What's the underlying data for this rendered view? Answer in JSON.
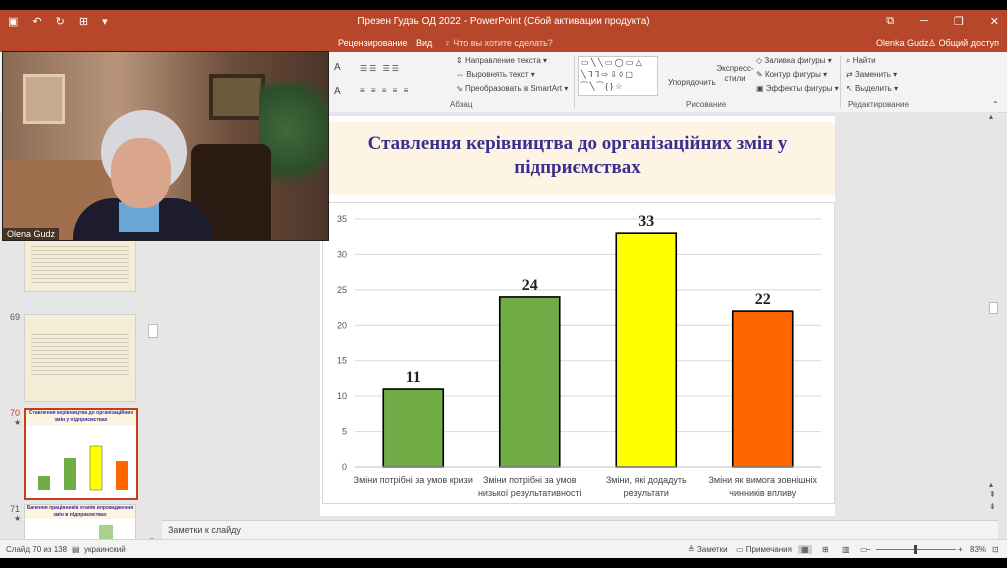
{
  "window": {
    "title": "Презен Гудзь ОД 2022  -  PowerPoint (Сбой активации продукта)",
    "user_name": "Olenka Gudz",
    "share_label": "Общий доступ"
  },
  "tabs": [
    "Рецензирование",
    "Вид"
  ],
  "tell_me": "Что вы хотите сделать?",
  "ribbon": {
    "text_direction": "Направление текста",
    "align_text": "Выровнять текст",
    "smartart": "Преобразовать в SmartArt",
    "paragraph_group": "Абзац",
    "arrange": "Упорядочить",
    "quick_styles": "Экспресс-стили",
    "drawing_group": "Рисование",
    "shape_fill": "Заливка фигуры",
    "shape_outline": "Контур фигуры",
    "shape_effects": "Эффекты фигуры",
    "find": "Найти",
    "replace": "Заменить",
    "select": "Выделить",
    "editing_group": "Редактирование"
  },
  "thumbnails": [
    {
      "number": "69",
      "active": false
    },
    {
      "number": "70",
      "active": true,
      "title": "Ставлення керівництва до організаційних змін у підприємствах"
    },
    {
      "number": "71",
      "active": false,
      "title": "Бачення працівників етапів впровадження змін в підприємствах"
    }
  ],
  "slide": {
    "title": "Ставлення керівництва до організаційних змін у підприємствах"
  },
  "chart_data": {
    "type": "bar",
    "categories": [
      "Зміни потрібні за умов кризи",
      "Зміни потрібні за умов низької результативності",
      "Зміни, які додадуть результати",
      "Зміни як вимога зовнішніх чинників впливу"
    ],
    "category_lines": [
      [
        "Зміни потрібні за умов кризи"
      ],
      [
        "Зміни потрібні за умов",
        "низької результативності"
      ],
      [
        "Зміни, які додадуть",
        "результати"
      ],
      [
        "Зміни як вимога зовнішніх",
        "чинників впливу"
      ]
    ],
    "values": [
      11,
      24,
      33,
      22
    ],
    "colors": [
      "#70ad47",
      "#70ad47",
      "#ffff00",
      "#ff6600"
    ],
    "yticks": [
      0,
      5,
      10,
      15,
      20,
      25,
      30,
      35
    ],
    "ylim": [
      0,
      35
    ],
    "grid": true,
    "title": "",
    "xlabel": "",
    "ylabel": ""
  },
  "notes_placeholder": "Заметки к слайду",
  "status": {
    "slide_info": "Слайд 70 из 138",
    "language": "украинский",
    "notes_btn": "Заметки",
    "comments_btn": "Примечания",
    "zoom": "83%"
  },
  "webcam": {
    "name": "Olena Gudz"
  }
}
